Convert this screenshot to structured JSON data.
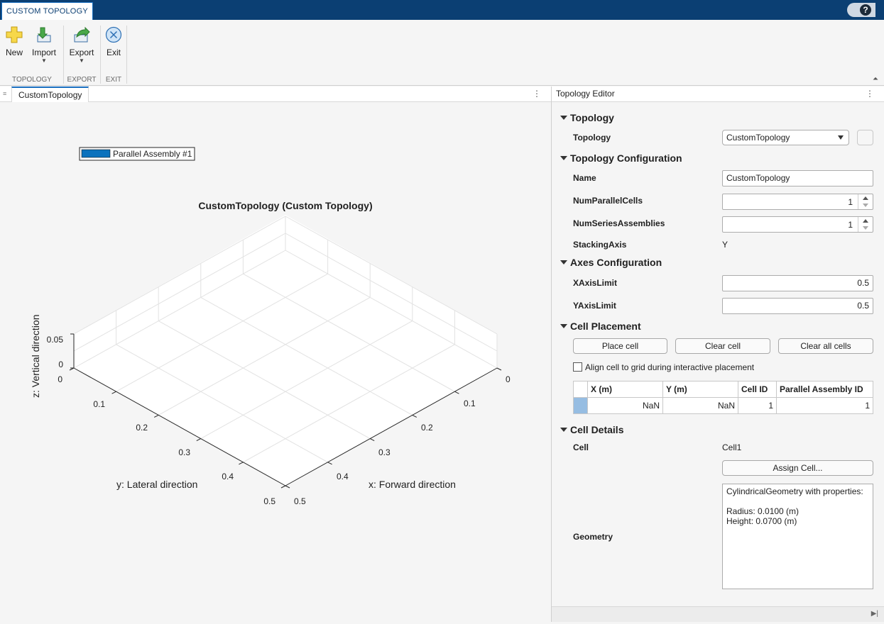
{
  "app": {
    "tab_title": "CUSTOM TOPOLOGY",
    "help_label": "?"
  },
  "toolstrip": {
    "buttons": [
      {
        "label": "New",
        "icon": "plus-icon"
      },
      {
        "label": "Import",
        "icon": "import-icon",
        "dropdown": "▼"
      },
      {
        "label": "Export",
        "icon": "export-icon",
        "dropdown": "▼"
      },
      {
        "label": "Exit",
        "icon": "close-circle-icon"
      }
    ],
    "groups": [
      "TOPOLOGY",
      "EXPORT",
      "EXIT"
    ]
  },
  "document": {
    "tab": "CustomTopology"
  },
  "plot": {
    "title": "CustomTopology (Custom Topology)",
    "legend": "Parallel Assembly #1",
    "legend_color": "#0b72bd",
    "xlabel": "x: Forward direction",
    "ylabel": "y: Lateral direction",
    "zlabel": "z: Vertical direction",
    "x_ticks": [
      "0",
      "0.1",
      "0.2",
      "0.3",
      "0.4",
      "0.5"
    ],
    "y_ticks": [
      "0",
      "0.1",
      "0.2",
      "0.3",
      "0.4",
      "0.5"
    ],
    "z_ticks": [
      "0",
      "0.05"
    ]
  },
  "editor": {
    "title": "Topology Editor",
    "sections": {
      "topology": "Topology",
      "config": "Topology Configuration",
      "axes": "Axes Configuration",
      "placement": "Cell Placement",
      "details": "Cell Details"
    },
    "topology": {
      "label": "Topology",
      "value": "CustomTopology"
    },
    "config": {
      "name_label": "Name",
      "name_value": "CustomTopology",
      "parallel_label": "NumParallelCells",
      "parallel_value": "1",
      "series_label": "NumSeriesAssemblies",
      "series_value": "1",
      "stacking_label": "StackingAxis",
      "stacking_value": "Y"
    },
    "axes": {
      "x_label": "XAxisLimit",
      "x_value": "0.5",
      "y_label": "YAxisLimit",
      "y_value": "0.5"
    },
    "placement": {
      "place": "Place cell",
      "clear": "Clear cell",
      "clear_all": "Clear all cells",
      "align_label": "Align cell to grid during interactive placement",
      "table": {
        "headers": [
          "X (m)",
          "Y (m)",
          "Cell ID",
          "Parallel Assembly ID"
        ],
        "rows": [
          [
            "NaN",
            "NaN",
            "1",
            "1"
          ]
        ]
      }
    },
    "details": {
      "cell_label": "Cell",
      "cell_value": "Cell1",
      "assign": "Assign Cell...",
      "geometry_label": "Geometry",
      "geometry_text": "CylindricalGeometry with properties:\n\nRadius: 0.0100 (m)\nHeight: 0.0700 (m)"
    }
  }
}
